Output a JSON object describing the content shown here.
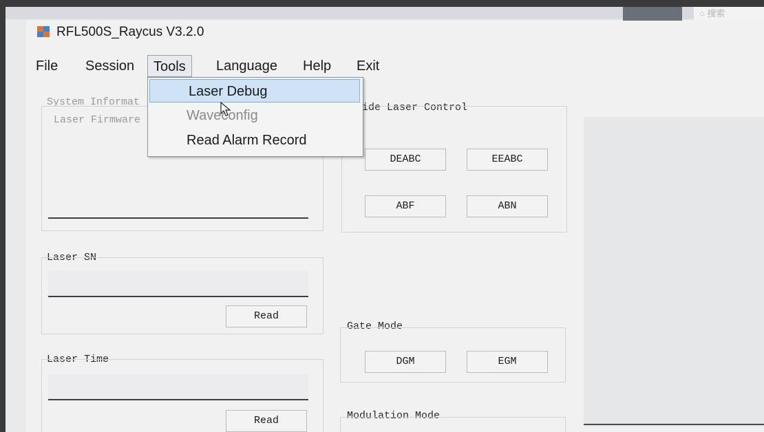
{
  "desktop": {
    "search_placeholder": "搜索"
  },
  "window": {
    "title": "RFL500S_Raycus V3.2.0"
  },
  "menubar": {
    "file": "File",
    "session": "Session",
    "tools": "Tools",
    "language": "Language",
    "help": "Help",
    "exit": "Exit"
  },
  "tools_menu": {
    "items": [
      {
        "label": "Laser Debug",
        "state": "highlighted"
      },
      {
        "label": "Waveconfig",
        "state": "disabled"
      },
      {
        "label": "Read Alarm Record",
        "state": "normal"
      }
    ]
  },
  "system_info": {
    "title": "System Informat",
    "firmware_label": "Laser Firmware"
  },
  "guide_laser": {
    "title": "ide Laser Control",
    "buttons": [
      "DEABC",
      "EEABC",
      "ABF",
      "ABN"
    ]
  },
  "laser_sn": {
    "title": "Laser SN",
    "read_button": "Read"
  },
  "laser_time": {
    "title": "Laser Time",
    "read_button": "Read"
  },
  "gate_mode": {
    "title": "Gate Mode",
    "buttons": [
      "DGM",
      "EGM"
    ]
  },
  "modulation_mode": {
    "title": "Modulation Mode"
  },
  "colors": {
    "menu_highlight": "#cfe3f7",
    "highlight_border": "#7eb0e2",
    "disabled_text": "#8a8a8a"
  },
  "icons": {
    "app": "app-icon",
    "cursor": "mouse-cursor-icon"
  }
}
